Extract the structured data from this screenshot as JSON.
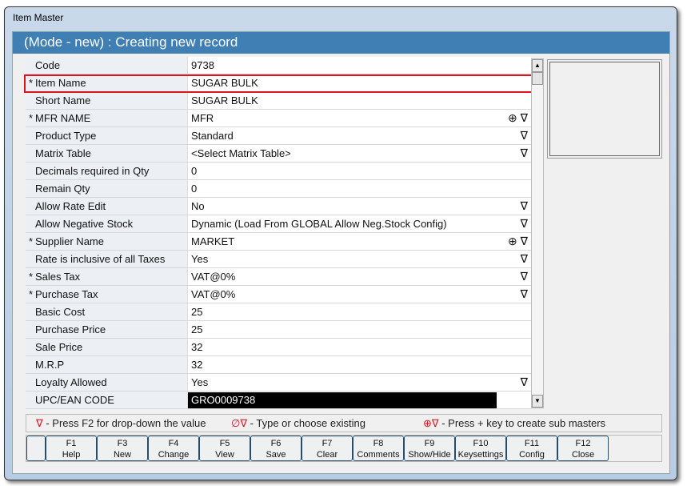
{
  "window_title": "Item Master",
  "header": "(Mode - new) : Creating new record",
  "rows": [
    {
      "label": "Code",
      "required": "",
      "value": "9738",
      "icons": ""
    },
    {
      "label": "Item Name",
      "required": "*",
      "value": "SUGAR BULK",
      "icons": ""
    },
    {
      "label": "Short Name",
      "required": "",
      "value": "SUGAR BULK",
      "icons": ""
    },
    {
      "label": "MFR NAME",
      "required": "*",
      "value": "MFR",
      "icons": "⊕ ∇"
    },
    {
      "label": "Product Type",
      "required": "",
      "value": "Standard",
      "icons": "∇"
    },
    {
      "label": "Matrix Table",
      "required": "",
      "value": "<Select Matrix Table>",
      "icons": "∇"
    },
    {
      "label": "Decimals required in Qty",
      "required": "",
      "value": "0",
      "icons": ""
    },
    {
      "label": "Remain Qty",
      "required": "",
      "value": "0",
      "icons": ""
    },
    {
      "label": "Allow Rate Edit",
      "required": "",
      "value": "No",
      "icons": "∇"
    },
    {
      "label": "Allow Negative Stock",
      "required": "",
      "value": "Dynamic (Load From GLOBAL Allow Neg.Stock Config)",
      "icons": "∇"
    },
    {
      "label": "Supplier Name",
      "required": "*",
      "value": "MARKET",
      "icons": "⊕ ∇"
    },
    {
      "label": "Rate is inclusive of all Taxes",
      "required": "",
      "value": "Yes",
      "icons": "∇"
    },
    {
      "label": "Sales Tax",
      "required": "*",
      "value": "VAT@0%",
      "icons": "∇"
    },
    {
      "label": "Purchase Tax",
      "required": "*",
      "value": "VAT@0%",
      "icons": "∇"
    },
    {
      "label": "Basic Cost",
      "required": "",
      "value": "25",
      "icons": ""
    },
    {
      "label": "Purchase Price",
      "required": "",
      "value": "25",
      "icons": ""
    },
    {
      "label": "Sale Price",
      "required": "",
      "value": "32",
      "icons": ""
    },
    {
      "label": "M.R.P",
      "required": "",
      "value": "32",
      "icons": ""
    },
    {
      "label": "Loyalty Allowed",
      "required": "",
      "value": "Yes",
      "icons": "∇"
    },
    {
      "label": "UPC/EAN CODE",
      "required": "",
      "value": "GRO0009738",
      "icons": ""
    }
  ],
  "legend": {
    "dropdown_icon": "∇",
    "dropdown_text": "- Press F2 for drop-down the value",
    "type_icon": "∅∇",
    "type_text": "- Type or choose existing",
    "sub_icon": "⊕∇",
    "sub_text": "- Press + key to create sub masters"
  },
  "buttons": [
    {
      "key": "F1",
      "label": "Help"
    },
    {
      "key": "F3",
      "label": "New"
    },
    {
      "key": "F4",
      "label": "Change"
    },
    {
      "key": "F5",
      "label": "View"
    },
    {
      "key": "F6",
      "label": "Save"
    },
    {
      "key": "F7",
      "label": "Clear"
    },
    {
      "key": "F8",
      "label": "Comments"
    },
    {
      "key": "F9",
      "label": "Show/Hide"
    },
    {
      "key": "F10",
      "label": "Keysettings"
    },
    {
      "key": "F11",
      "label": "Config"
    },
    {
      "key": "F12",
      "label": "Close"
    }
  ]
}
